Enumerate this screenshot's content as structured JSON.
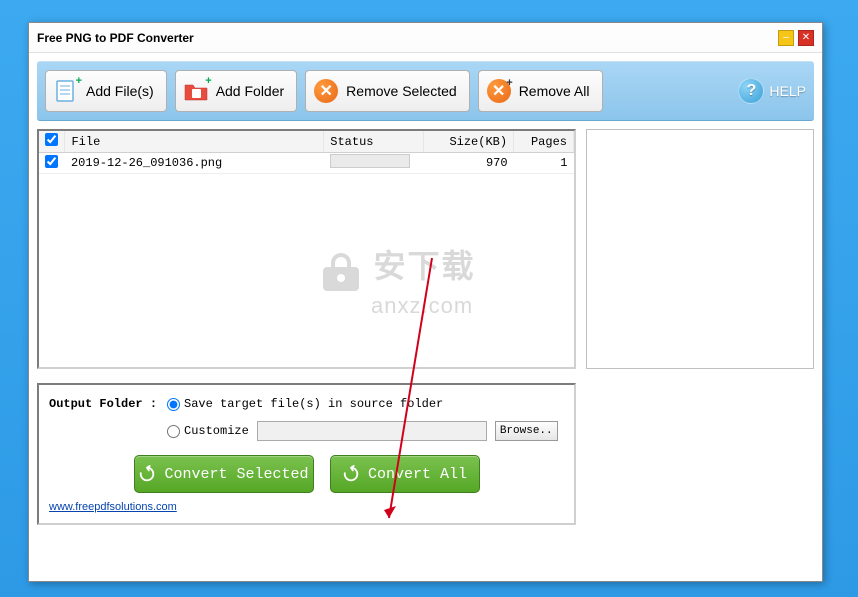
{
  "window": {
    "title": "Free PNG to PDF Converter"
  },
  "toolbar": {
    "add_files": "Add File(s)",
    "add_folder": "Add Folder",
    "remove_selected": "Remove Selected",
    "remove_all": "Remove All",
    "help": "HELP"
  },
  "table": {
    "headers": {
      "file": "File",
      "status": "Status",
      "size": "Size(KB)",
      "pages": "Pages"
    },
    "rows": [
      {
        "checked": true,
        "file": "2019-12-26_091036.png",
        "status": "",
        "size": "970",
        "pages": "1"
      }
    ]
  },
  "watermark": {
    "cn": "安下载",
    "en": "anxz.com"
  },
  "output": {
    "label": "Output Folder :",
    "option_source": "Save target file(s) in source folder",
    "option_custom": "Customize",
    "browse": "Browse..",
    "custom_path": ""
  },
  "actions": {
    "convert_selected": "Convert Selected",
    "convert_all": "Convert All"
  },
  "link": {
    "url": "www.freepdfsolutions.com"
  }
}
